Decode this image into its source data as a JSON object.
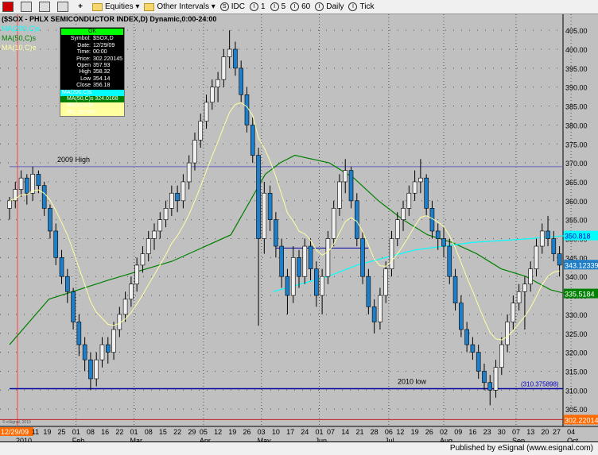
{
  "toolbar": {
    "items": [
      {
        "label": "",
        "icon": "chart-window-icon"
      },
      {
        "label": "",
        "icon": "link-icon"
      },
      {
        "label": "",
        "icon": "link-page-icon"
      },
      {
        "label": "",
        "icon": "properties-icon"
      },
      {
        "label": "+",
        "icon": "crosshair-icon"
      },
      {
        "label": "Equities ▾",
        "icon": "folder-icon"
      },
      {
        "label": "Other Intervals ▾",
        "icon": "folder-icon"
      },
      {
        "label": "IDC",
        "icon": "S"
      },
      {
        "label": "1",
        "icon": "I"
      },
      {
        "label": "5",
        "icon": "I"
      },
      {
        "label": "60",
        "icon": "I"
      },
      {
        "label": "Daily",
        "icon": "I"
      },
      {
        "label": "Tick",
        "icon": "I"
      }
    ]
  },
  "legend": {
    "title": "($SOX - PHLX SEMICONDUCTOR INDEX,D) Dynamic,0:00-24:00",
    "ma200": "MA(200,C)s",
    "ma50": "MA(50,C)s",
    "ma10": "MA(10,C)e"
  },
  "tooltip": {
    "header": "OK",
    "rows": [
      [
        "Symbol:",
        "$SOX,D"
      ],
      [
        "Date:",
        "12/29/09"
      ],
      [
        "Time:",
        "00:00"
      ],
      [
        "Price:",
        "302.220145"
      ],
      [
        "Open",
        "357.93"
      ],
      [
        "High",
        "358.32"
      ],
      [
        "Low",
        "354.14"
      ],
      [
        "Close",
        "356.18"
      ]
    ],
    "ma200": "MA(200,C)s",
    "ma50": "MA(50,C)s 324.0168",
    "ma10": "MA(10,C)e 351.357907"
  },
  "footer": "Published by eSignal (www.esignal.com)",
  "colors": {
    "up": "#f0f0f0",
    "down": "#1e7fc8",
    "ma200": "#00ffff",
    "ma50": "#008000",
    "ma10": "#ffffa0",
    "high_line": "#6060c0",
    "low_line": "#0000a0",
    "cursor": "#ff0000"
  },
  "chart_data": {
    "type": "candlestick",
    "title": "($SOX - PHLX SEMICONDUCTOR INDEX,D) Dynamic,0:00-24:00",
    "ylim": [
      302,
      407
    ],
    "y_ticks": [
      "405.00",
      "400.00",
      "395.00",
      "390.00",
      "385.00",
      "380.00",
      "375.00",
      "370.00",
      "365.00",
      "360.00",
      "355.00",
      "350.00",
      "345.00",
      "340.00",
      "335.00",
      "330.00",
      "325.00",
      "320.00",
      "315.00",
      "310.00",
      "305.00"
    ],
    "x_ticks": [
      {
        "i": 0,
        "t": "12/29/09",
        "hl": true
      },
      {
        "i": 4.5,
        "t": "11"
      },
      {
        "i": 6.5,
        "t": "19"
      },
      {
        "i": 9,
        "t": "25"
      },
      {
        "i": 11.5,
        "t": "01",
        "m": "Feb"
      },
      {
        "i": 14,
        "t": "08"
      },
      {
        "i": 16.5,
        "t": "16"
      },
      {
        "i": 19,
        "t": "22"
      },
      {
        "i": 21.5,
        "t": "01",
        "m": "Mar"
      },
      {
        "i": 24,
        "t": "08"
      },
      {
        "i": 26.5,
        "t": "15"
      },
      {
        "i": 29,
        "t": "22"
      },
      {
        "i": 31.5,
        "t": "29"
      },
      {
        "i": 33.5,
        "t": "05",
        "m": "Apr"
      },
      {
        "i": 36,
        "t": "12"
      },
      {
        "i": 38.5,
        "t": "19"
      },
      {
        "i": 41,
        "t": "26"
      },
      {
        "i": 43.5,
        "t": "03",
        "m": "May"
      },
      {
        "i": 46,
        "t": "10"
      },
      {
        "i": 48.5,
        "t": "17"
      },
      {
        "i": 51,
        "t": "24"
      },
      {
        "i": 53.5,
        "t": "01",
        "m": "Jun"
      },
      {
        "i": 55.5,
        "t": "07"
      },
      {
        "i": 58,
        "t": "14"
      },
      {
        "i": 60.5,
        "t": "21"
      },
      {
        "i": 63,
        "t": "28"
      },
      {
        "i": 65.5,
        "t": "06",
        "m": "Jul"
      },
      {
        "i": 67.5,
        "t": "12"
      },
      {
        "i": 70,
        "t": "19"
      },
      {
        "i": 72.5,
        "t": "26"
      },
      {
        "i": 75,
        "t": "02",
        "m": "Aug"
      },
      {
        "i": 77.5,
        "t": "09"
      },
      {
        "i": 80,
        "t": "16"
      },
      {
        "i": 82.5,
        "t": "23"
      },
      {
        "i": 85,
        "t": "30"
      },
      {
        "i": 87.5,
        "t": "07",
        "m": "Sep"
      },
      {
        "i": 90,
        "t": "13"
      },
      {
        "i": 92.5,
        "t": "20"
      },
      {
        "i": 94.5,
        "t": "27"
      },
      {
        "i": 97,
        "t": "04",
        "m": "Oct"
      }
    ],
    "year_label": "2010",
    "ohlc": [
      [
        358,
        361,
        355,
        360
      ],
      [
        360,
        365,
        358,
        363
      ],
      [
        363,
        368,
        361,
        366
      ],
      [
        366,
        367,
        359,
        362
      ],
      [
        362,
        369,
        360,
        367
      ],
      [
        367,
        368,
        362,
        364
      ],
      [
        364,
        365,
        356,
        358
      ],
      [
        358,
        359,
        350,
        352
      ],
      [
        352,
        354,
        343,
        345
      ],
      [
        345,
        347,
        338,
        340
      ],
      [
        340,
        342,
        333,
        336
      ],
      [
        336,
        337,
        326,
        328
      ],
      [
        328,
        330,
        319,
        322
      ],
      [
        322,
        324,
        315,
        318
      ],
      [
        318,
        320,
        310,
        313
      ],
      [
        313,
        320,
        311,
        318
      ],
      [
        318,
        324,
        316,
        322
      ],
      [
        322,
        324,
        317,
        320
      ],
      [
        320,
        328,
        318,
        326
      ],
      [
        326,
        332,
        324,
        330
      ],
      [
        330,
        336,
        328,
        334
      ],
      [
        334,
        340,
        332,
        338
      ],
      [
        338,
        345,
        336,
        343
      ],
      [
        343,
        348,
        341,
        346
      ],
      [
        346,
        352,
        344,
        350
      ],
      [
        350,
        354,
        347,
        352
      ],
      [
        352,
        357,
        350,
        355
      ],
      [
        355,
        360,
        353,
        358
      ],
      [
        358,
        364,
        356,
        362
      ],
      [
        362,
        364,
        357,
        360
      ],
      [
        360,
        367,
        358,
        365
      ],
      [
        365,
        372,
        363,
        370
      ],
      [
        370,
        378,
        368,
        376
      ],
      [
        376,
        383,
        374,
        381
      ],
      [
        381,
        388,
        379,
        386
      ],
      [
        386,
        392,
        384,
        390
      ],
      [
        390,
        394,
        386,
        392
      ],
      [
        392,
        400,
        390,
        398
      ],
      [
        398,
        405,
        395,
        400
      ],
      [
        400,
        402,
        393,
        395
      ],
      [
        395,
        397,
        386,
        388
      ],
      [
        388,
        390,
        378,
        380
      ],
      [
        380,
        382,
        370,
        372
      ],
      [
        372,
        374,
        327,
        350
      ],
      [
        350,
        365,
        346,
        362
      ],
      [
        362,
        364,
        352,
        355
      ],
      [
        355,
        357,
        345,
        348
      ],
      [
        348,
        350,
        337,
        340
      ],
      [
        340,
        342,
        330,
        335
      ],
      [
        335,
        348,
        333,
        345
      ],
      [
        345,
        347,
        337,
        340
      ],
      [
        340,
        350,
        338,
        348
      ],
      [
        348,
        350,
        339,
        342
      ],
      [
        342,
        344,
        332,
        335
      ],
      [
        335,
        342,
        330,
        340
      ],
      [
        340,
        352,
        338,
        350
      ],
      [
        350,
        360,
        348,
        358
      ],
      [
        358,
        367,
        356,
        365
      ],
      [
        365,
        371,
        362,
        368
      ],
      [
        368,
        369,
        358,
        360
      ],
      [
        360,
        362,
        348,
        350
      ],
      [
        350,
        352,
        338,
        340
      ],
      [
        340,
        342,
        330,
        332
      ],
      [
        332,
        334,
        325,
        328
      ],
      [
        328,
        337,
        326,
        335
      ],
      [
        335,
        344,
        333,
        342
      ],
      [
        342,
        352,
        340,
        350
      ],
      [
        350,
        357,
        348,
        355
      ],
      [
        355,
        360,
        352,
        358
      ],
      [
        358,
        364,
        356,
        362
      ],
      [
        362,
        368,
        360,
        365
      ],
      [
        365,
        371,
        362,
        366
      ],
      [
        366,
        367,
        356,
        358
      ],
      [
        358,
        360,
        350,
        352
      ],
      [
        352,
        354,
        347,
        350
      ],
      [
        350,
        353,
        345,
        348
      ],
      [
        348,
        350,
        338,
        340
      ],
      [
        340,
        342,
        331,
        333
      ],
      [
        333,
        335,
        324,
        326
      ],
      [
        326,
        328,
        320,
        322
      ],
      [
        322,
        324,
        318,
        320
      ],
      [
        320,
        322,
        313,
        315
      ],
      [
        315,
        317,
        310,
        312
      ],
      [
        312,
        314,
        306,
        310
      ],
      [
        310,
        318,
        308,
        316
      ],
      [
        316,
        324,
        314,
        322
      ],
      [
        322,
        330,
        320,
        328
      ],
      [
        328,
        335,
        326,
        333
      ],
      [
        333,
        338,
        331,
        336
      ],
      [
        336,
        340,
        326,
        338
      ],
      [
        338,
        344,
        336,
        342
      ],
      [
        342,
        350,
        340,
        348
      ],
      [
        348,
        354,
        346,
        352
      ],
      [
        352,
        356,
        348,
        350
      ],
      [
        350,
        352,
        344,
        346
      ],
      [
        346,
        348,
        340,
        343
      ]
    ],
    "ma50": [
      [
        0,
        322
      ],
      [
        8,
        334
      ],
      [
        20,
        339
      ],
      [
        33,
        344
      ],
      [
        45,
        351
      ],
      [
        52,
        367
      ],
      [
        55,
        370
      ],
      [
        58,
        372
      ],
      [
        65,
        370
      ],
      [
        70,
        366
      ],
      [
        75,
        360
      ],
      [
        80,
        355
      ],
      [
        85,
        351
      ],
      [
        90,
        349
      ],
      [
        95,
        346
      ],
      [
        100,
        342
      ],
      [
        105,
        340
      ],
      [
        110,
        336.5
      ],
      [
        113,
        335.5
      ]
    ],
    "ma200": [
      [
        45.5,
        336
      ],
      [
        55,
        340
      ],
      [
        60,
        343
      ],
      [
        65,
        345
      ],
      [
        70,
        347
      ],
      [
        80,
        349
      ],
      [
        90,
        350
      ],
      [
        96,
        350.8
      ]
    ],
    "lines": [
      {
        "label": "2009 High",
        "value": 369,
        "from": 0,
        "to": 96
      },
      {
        "label": "",
        "value": 347.5,
        "from": 46,
        "to": 62
      },
      {
        "label": "2010 low",
        "value": 310.375898,
        "from": 0,
        "to": 96,
        "tag": "(310.375898)"
      }
    ],
    "badges": [
      {
        "text": "350.818",
        "value": 350.818,
        "bg": "#00ffff",
        "fg": "#0000c0"
      },
      {
        "text": "343.123391",
        "value": 343.12,
        "bg": "#1e7fc8",
        "fg": "#fff"
      },
      {
        "text": "335.5184",
        "value": 335.5184,
        "bg": "#008000",
        "fg": "#fff"
      },
      {
        "text": "302.220145",
        "value": 302.22,
        "bg": "#ff6a00",
        "fg": "#fff"
      }
    ],
    "cursor_price": 302.220145,
    "watermark": "© eSignal, 2010"
  }
}
